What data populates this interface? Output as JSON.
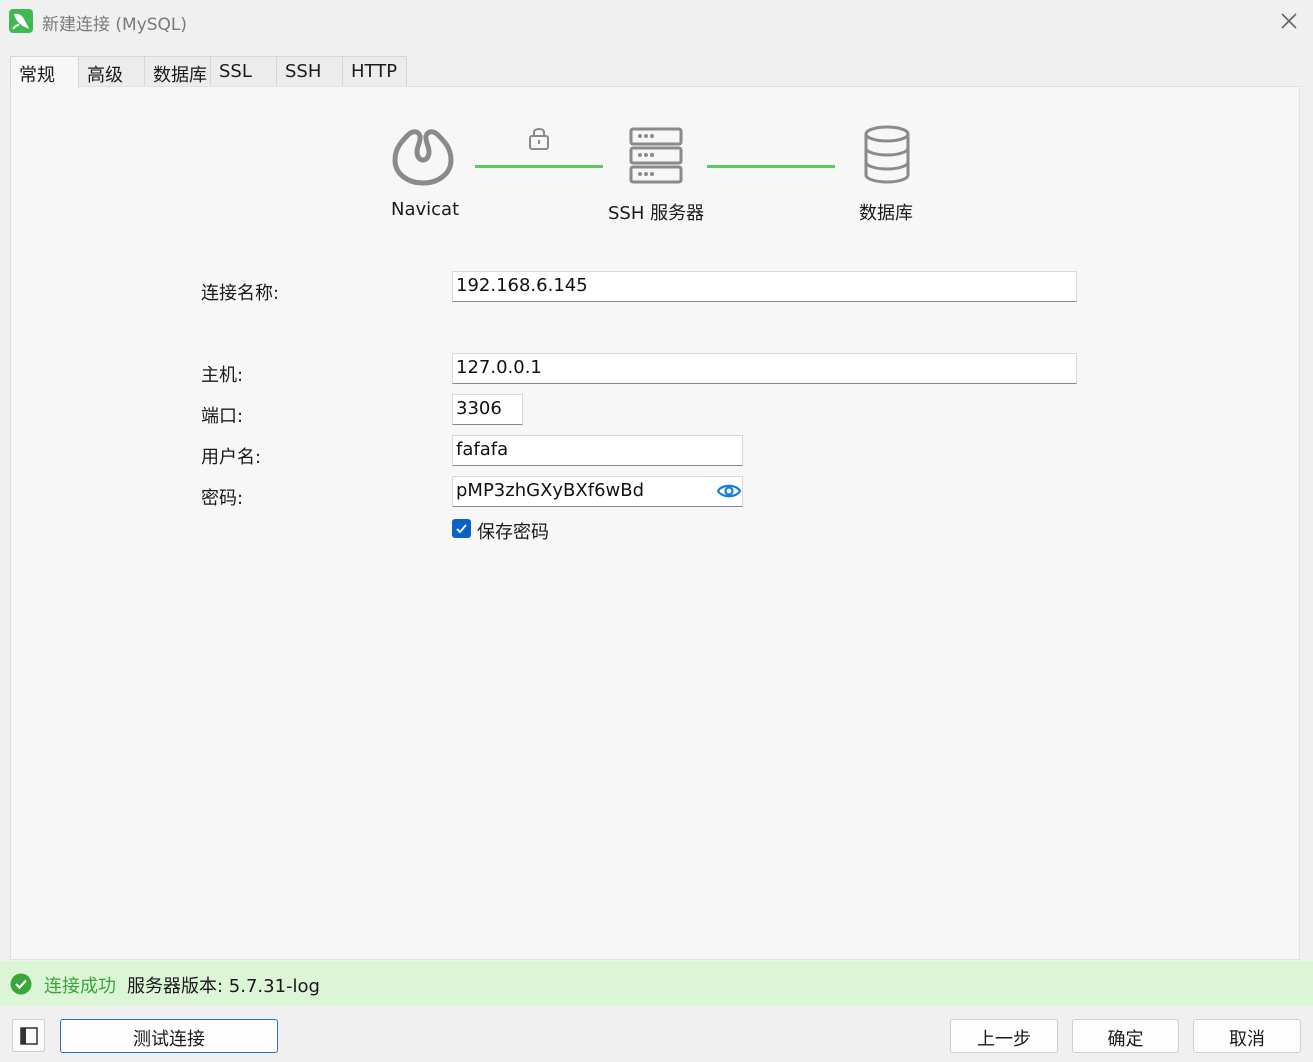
{
  "window": {
    "title": "新建连接 (MySQL)",
    "app_icon": "navicat-dolphin-icon",
    "close_icon": "close-icon"
  },
  "tabs": [
    {
      "label": "常规",
      "active": true
    },
    {
      "label": "高级"
    },
    {
      "label": "数据库"
    },
    {
      "label": "SSL"
    },
    {
      "label": "SSH"
    },
    {
      "label": "HTTP"
    }
  ],
  "diagram": {
    "navicat_label": "Navicat",
    "ssh_label": "SSH 服务器",
    "database_label": "数据库",
    "connector_color": "#5cc95c"
  },
  "form": {
    "connection_name_label": "连接名称:",
    "connection_name_value": "192.168.6.145",
    "host_label": "主机:",
    "host_value": "127.0.0.1",
    "port_label": "端口:",
    "port_value": "3306",
    "username_label": "用户名:",
    "username_value": "fafafa",
    "password_label": "密码:",
    "password_value": "pMP3zhGXyBXf6wBd",
    "save_password_label": "保存密码",
    "save_password_checked": true
  },
  "status": {
    "success_text": "连接成功",
    "version_text": "服务器版本: 5.7.31-log",
    "color": "#3aa53a"
  },
  "buttons": {
    "test_connection": "测试连接",
    "previous": "上一步",
    "ok": "确定",
    "cancel": "取消"
  }
}
